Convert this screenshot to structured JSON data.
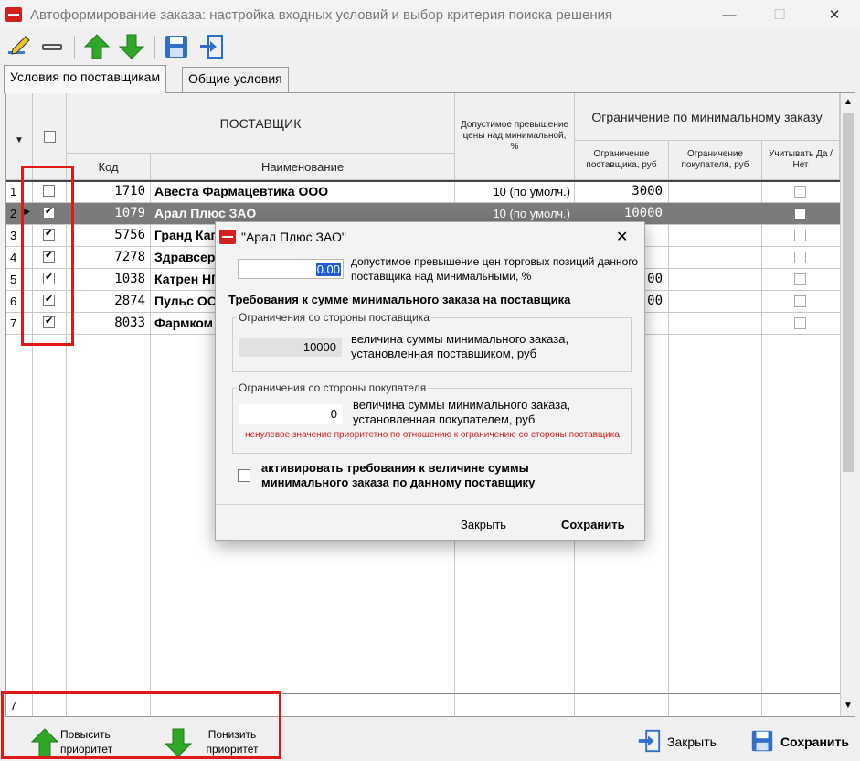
{
  "window": {
    "title": "Автоформирование заказа: настройка входных условий и выбор критерия поиска решения",
    "minimize": "—",
    "maximize": "☐",
    "close": "✕"
  },
  "toolbar": {
    "icons": [
      "edit-pencil-icon",
      "minus-icon",
      "arrow-up-icon",
      "arrow-down-icon",
      "save-disk-icon",
      "exit-icon"
    ]
  },
  "tabs": [
    {
      "label": "Условия по поставщикам",
      "active": true
    },
    {
      "label": "Общие условия",
      "active": false
    }
  ],
  "grid": {
    "headers": {
      "supplier": "ПОСТАВЩИК",
      "code": "Код",
      "name": "Наименование",
      "allowed_excess": "Допустимое превышение цены над минимальной, %",
      "min_order_group": "Ограничение по минимальному заказу",
      "supplier_limit": "Ограничение поставщика, руб",
      "buyer_limit": "Ограничение покупателя, руб",
      "consider": "Учитывать Да / Нет"
    },
    "rows": [
      {
        "num": "1",
        "checked": false,
        "code": "1710",
        "name": "Авеста Фармацевтика ООО",
        "excess": "10 (по умолч.)",
        "supplier_limit": "3000",
        "buyer_limit": "",
        "consider": false
      },
      {
        "num": "2",
        "checked": true,
        "code": "1079",
        "name": "Арал Плюс ЗАО",
        "excess": "10 (по умолч.)",
        "supplier_limit": "10000",
        "buyer_limit": "",
        "consider": false
      },
      {
        "num": "3",
        "checked": true,
        "code": "5756",
        "name": "Гранд Кап",
        "excess": "",
        "supplier_limit": "",
        "buyer_limit": "",
        "consider": false
      },
      {
        "num": "4",
        "checked": true,
        "code": "7278",
        "name": "Здравсер",
        "excess": "",
        "supplier_limit": "",
        "buyer_limit": "",
        "consider": false
      },
      {
        "num": "5",
        "checked": true,
        "code": "1038",
        "name": "Катрен НП",
        "excess": "",
        "supplier_limit": "00",
        "buyer_limit": "",
        "consider": false
      },
      {
        "num": "6",
        "checked": true,
        "code": "2874",
        "name": "Пульс ООО",
        "excess": "",
        "supplier_limit": "00",
        "buyer_limit": "",
        "consider": false
      },
      {
        "num": "7",
        "checked": true,
        "code": "8033",
        "name": "Фармком",
        "excess": "",
        "supplier_limit": "",
        "buyer_limit": "",
        "consider": false
      }
    ],
    "footer_count": "7"
  },
  "bottom": {
    "raise_priority": "Повысить приоритет",
    "lower_priority": "Понизить приоритет",
    "close": "Закрыть",
    "save": "Сохранить"
  },
  "dialog": {
    "title": "\"Арал Плюс ЗАО\"",
    "close_glyph": "✕",
    "excess_value": "0.00",
    "excess_label": "допустимое превышение цен торговых позиций данного поставщика над минимальными, %",
    "section_title": "Требования к сумме минимального заказа на поставщика",
    "supplier_group": "Ограничения со стороны поставщика",
    "supplier_value": "10000",
    "supplier_label": "величина суммы минимального заказа, установленная поставщиком, руб",
    "buyer_group": "Ограничения со стороны покупателя",
    "buyer_value": "0",
    "buyer_label": "величина суммы минимального заказа, установленная покупателем, руб",
    "buyer_note": "ненулевое значение приоритетно по отношению к ограничению со стороны поставщика",
    "activate_label": "активировать требования к величине суммы минимального заказа по данному поставщику",
    "close_button": "Закрыть",
    "save_button": "Сохранить"
  }
}
